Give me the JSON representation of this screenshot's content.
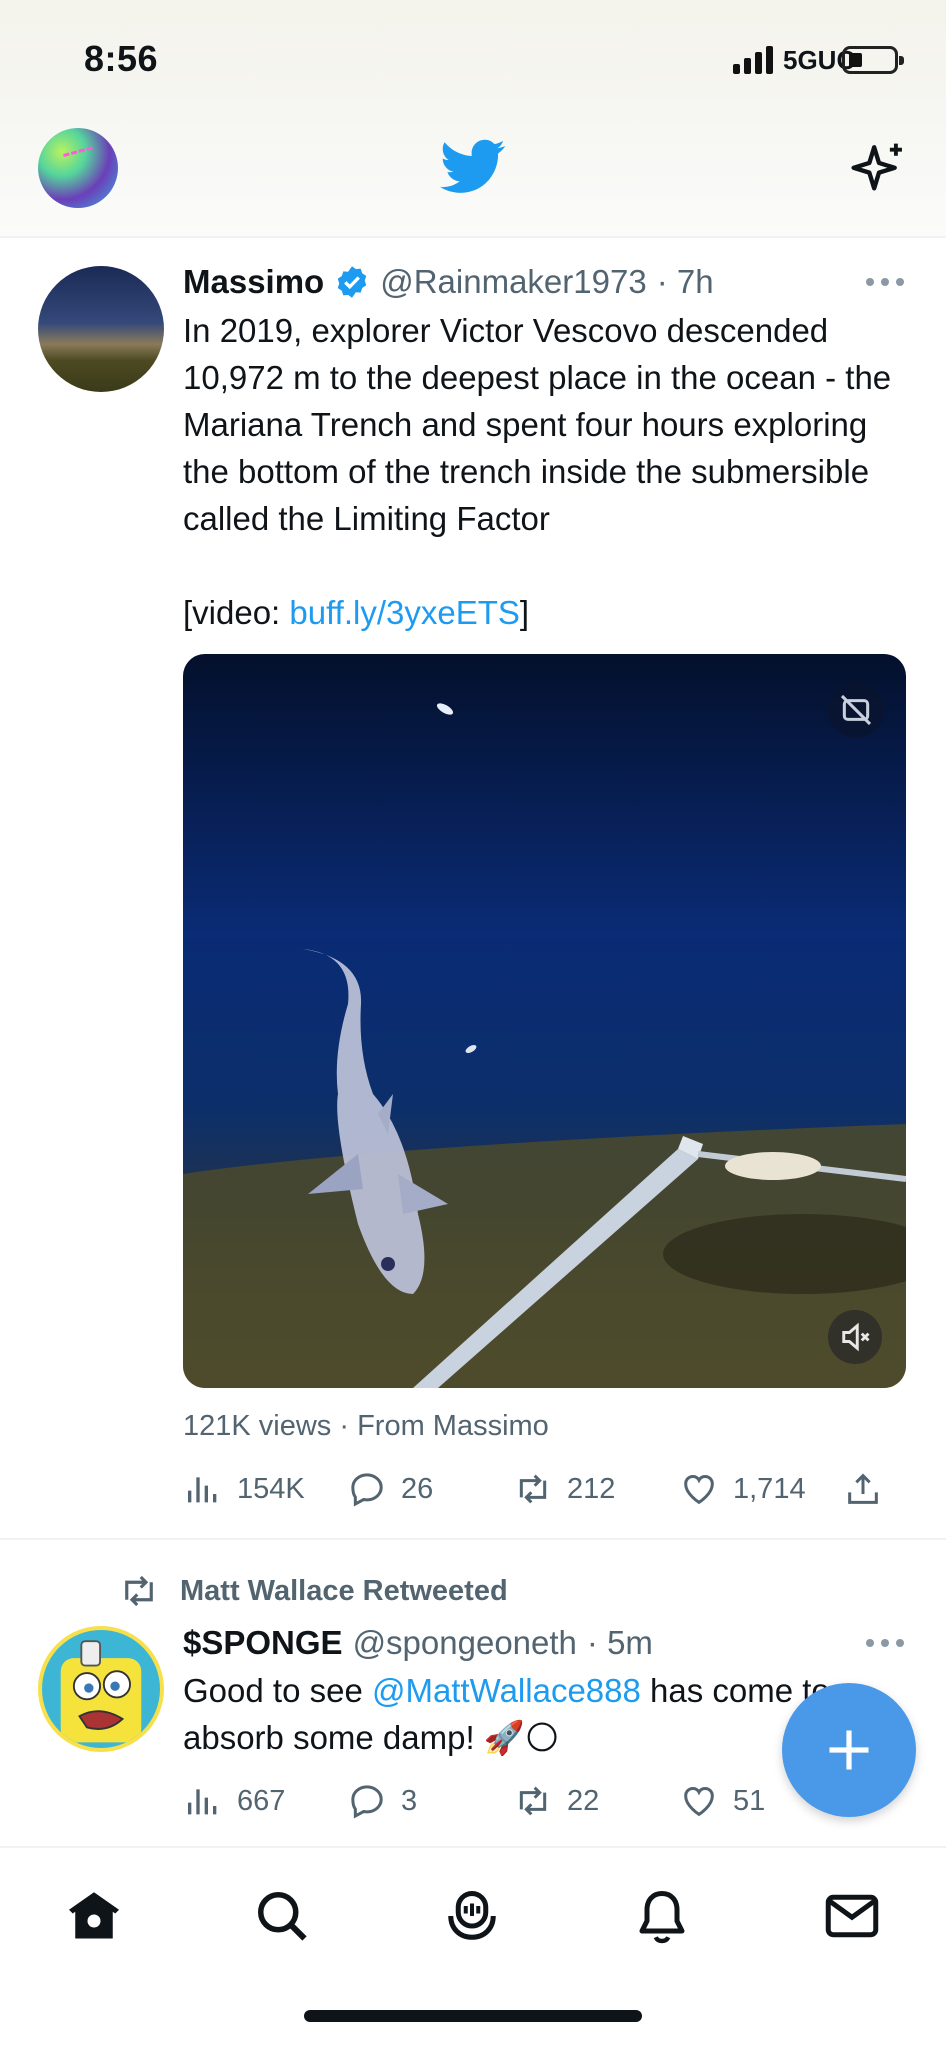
{
  "status_bar": {
    "time": "8:56",
    "network": "5GUC"
  },
  "header": {
    "logo": "twitter-bird-icon",
    "right_icon": "sparkle-icon",
    "left": "profile-avatar"
  },
  "tweet1": {
    "name": "Massimo",
    "handle": "@Rainmaker1973",
    "time": "· 7h",
    "text_main": "In 2019, explorer Victor Vescovo descended 10,972 m to the deepest place in the ocean - the Mariana Trench  and spent four hours exploring the bottom of the trench inside the submersible called the Limiting Factor",
    "video_prefix": "[video: ",
    "video_link": "buff.ly/3yxeETS",
    "video_suffix": "]",
    "views_line": "121K views · From Massimo",
    "stats": {
      "views": "154K",
      "replies": "26",
      "retweets": "212",
      "likes": "1,714"
    }
  },
  "tweet2": {
    "retweeted_by": "Matt Wallace Retweeted",
    "name": "$SPONGE",
    "handle": "@spongeoneth",
    "time": "· 5m",
    "text_start": "Good to see ",
    "mention": "@MattWallace888",
    "text_end": " has come to absorb some damp! ",
    "emojis": "🚀🌕",
    "stats": {
      "views": "667",
      "replies": "3",
      "retweets": "22",
      "likes": "51"
    }
  },
  "colors": {
    "accent": "#1d9bf0",
    "fab": "#4a99e9",
    "muted": "#536471"
  },
  "bottom_nav": [
    "home-icon",
    "search-icon",
    "spaces-icon",
    "notifications-icon",
    "messages-icon"
  ]
}
